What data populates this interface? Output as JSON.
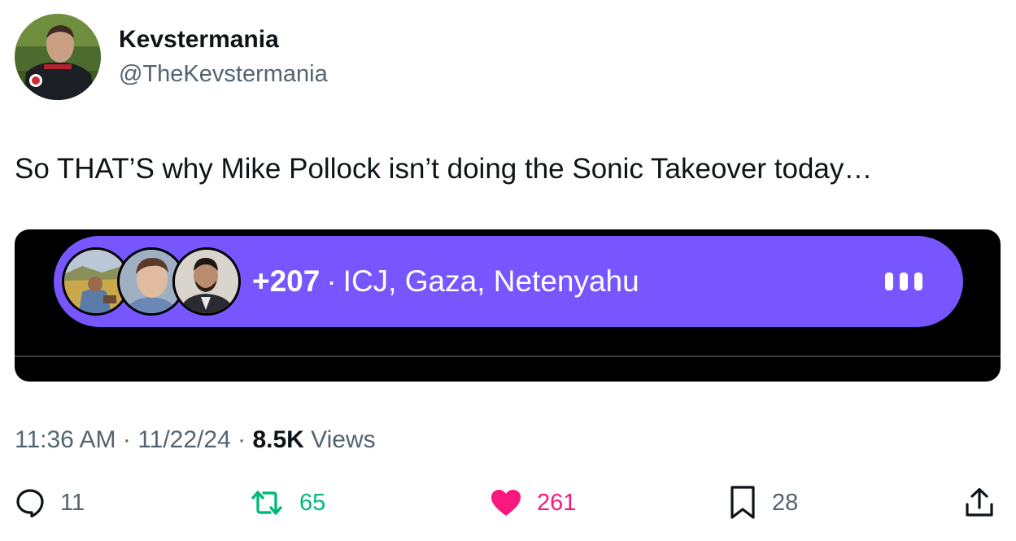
{
  "author": {
    "display_name": "Kevstermania",
    "handle": "@TheKevstermania"
  },
  "tweet": {
    "text": "So THAT’S why Mike Pollock isn’t doing the Sonic Takeover today…"
  },
  "space": {
    "listener_count": "+207",
    "separator": "·",
    "title": "ICJ, Gaza, Netenyahu",
    "accent_color": "#7856ff",
    "icons": [
      "speaker-avatar",
      "speaker-avatar",
      "speaker-avatar",
      "audio-equalizer-icon"
    ]
  },
  "meta": {
    "time": "11:36 AM",
    "sep1": " · ",
    "date": "11/22/24",
    "sep2": " · ",
    "views_count": "8.5K",
    "views_label": " Views"
  },
  "actions": {
    "reply_count": "11",
    "retweet_count": "65",
    "like_count": "261",
    "bookmark_count": "28",
    "colors": {
      "retweet": "#00ba7c",
      "like": "#f91880",
      "muted": "#536471"
    }
  }
}
